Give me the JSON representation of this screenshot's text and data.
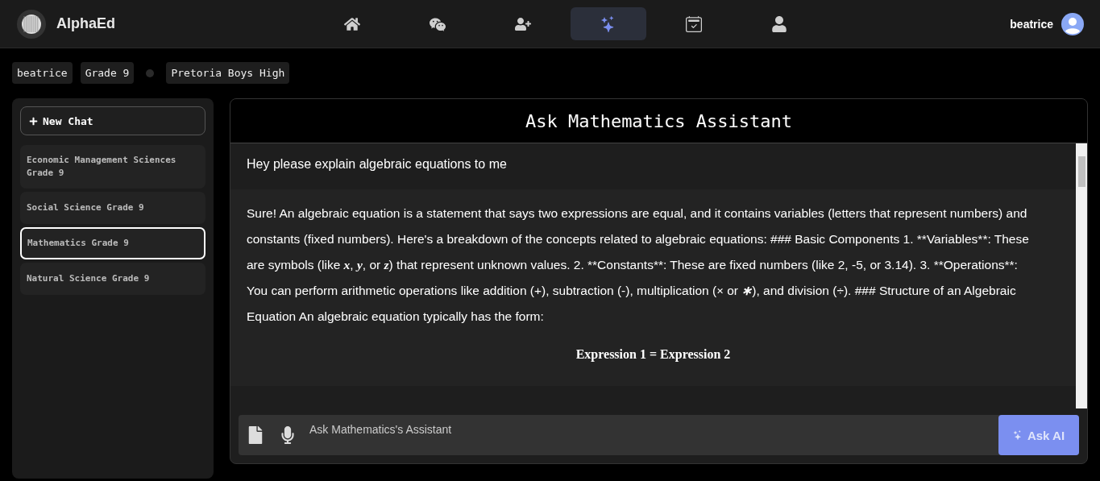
{
  "brand": {
    "name": "AlphaEd"
  },
  "nav": [
    {
      "kind": "home",
      "selected": false
    },
    {
      "kind": "chat",
      "selected": false
    },
    {
      "kind": "invite",
      "selected": false
    },
    {
      "kind": "assistant",
      "selected": true
    },
    {
      "kind": "planner",
      "selected": false
    },
    {
      "kind": "profile",
      "selected": false
    }
  ],
  "user": {
    "name": "beatrice"
  },
  "profile_tags": [
    "beatrice",
    "Grade 9",
    "Pretoria Boys High"
  ],
  "sidebar": {
    "new_chat": "New Chat",
    "items": [
      {
        "label": "Economic Management Sciences Grade 9",
        "selected": false
      },
      {
        "label": "Social Science Grade 9",
        "selected": false
      },
      {
        "label": "Mathematics Grade 9",
        "selected": true
      },
      {
        "label": "Natural Science Grade 9",
        "selected": false
      }
    ]
  },
  "chat": {
    "title": "Ask Mathematics Assistant",
    "messages": [
      {
        "kind": "user",
        "parts": [
          {
            "kind": "text",
            "text": "Hey please explain algebraic equations to me"
          }
        ]
      },
      {
        "kind": "assistant",
        "parts": [
          {
            "kind": "text",
            "text": "Sure! An algebraic equation is a statement that says two expressions are equal, and it contains variables (letters that represent numbers) and constants (fixed numbers). Here's a breakdown of the concepts related to algebraic equations: ### Basic Components 1. **Variables**: These are symbols (like "
          },
          {
            "kind": "math",
            "text": "x"
          },
          {
            "kind": "text",
            "text": ", "
          },
          {
            "kind": "math",
            "text": "y"
          },
          {
            "kind": "text",
            "text": ", or "
          },
          {
            "kind": "math",
            "text": "z"
          },
          {
            "kind": "text",
            "text": ") that represent unknown values. 2. **Constants**: These are fixed numbers (like 2, -5, or 3.14). 3. **Operations**: You can perform arithmetic operations like addition (+), subtraction (-), multiplication ("
          },
          {
            "kind": "math",
            "text": "×"
          },
          {
            "kind": "text",
            "text": " or "
          },
          {
            "kind": "math",
            "text": "∗"
          },
          {
            "kind": "text",
            "text": "), and division (÷). ### Structure of an Algebraic Equation An algebraic equation typically has the form:"
          }
        ]
      },
      {
        "kind": "formula",
        "parts": [
          {
            "kind": "text",
            "text": "Expression 1 = Expression 2"
          }
        ]
      }
    ],
    "input": {
      "placeholder": "Ask Mathematics's Assistant"
    },
    "ask_button": "Ask AI"
  }
}
